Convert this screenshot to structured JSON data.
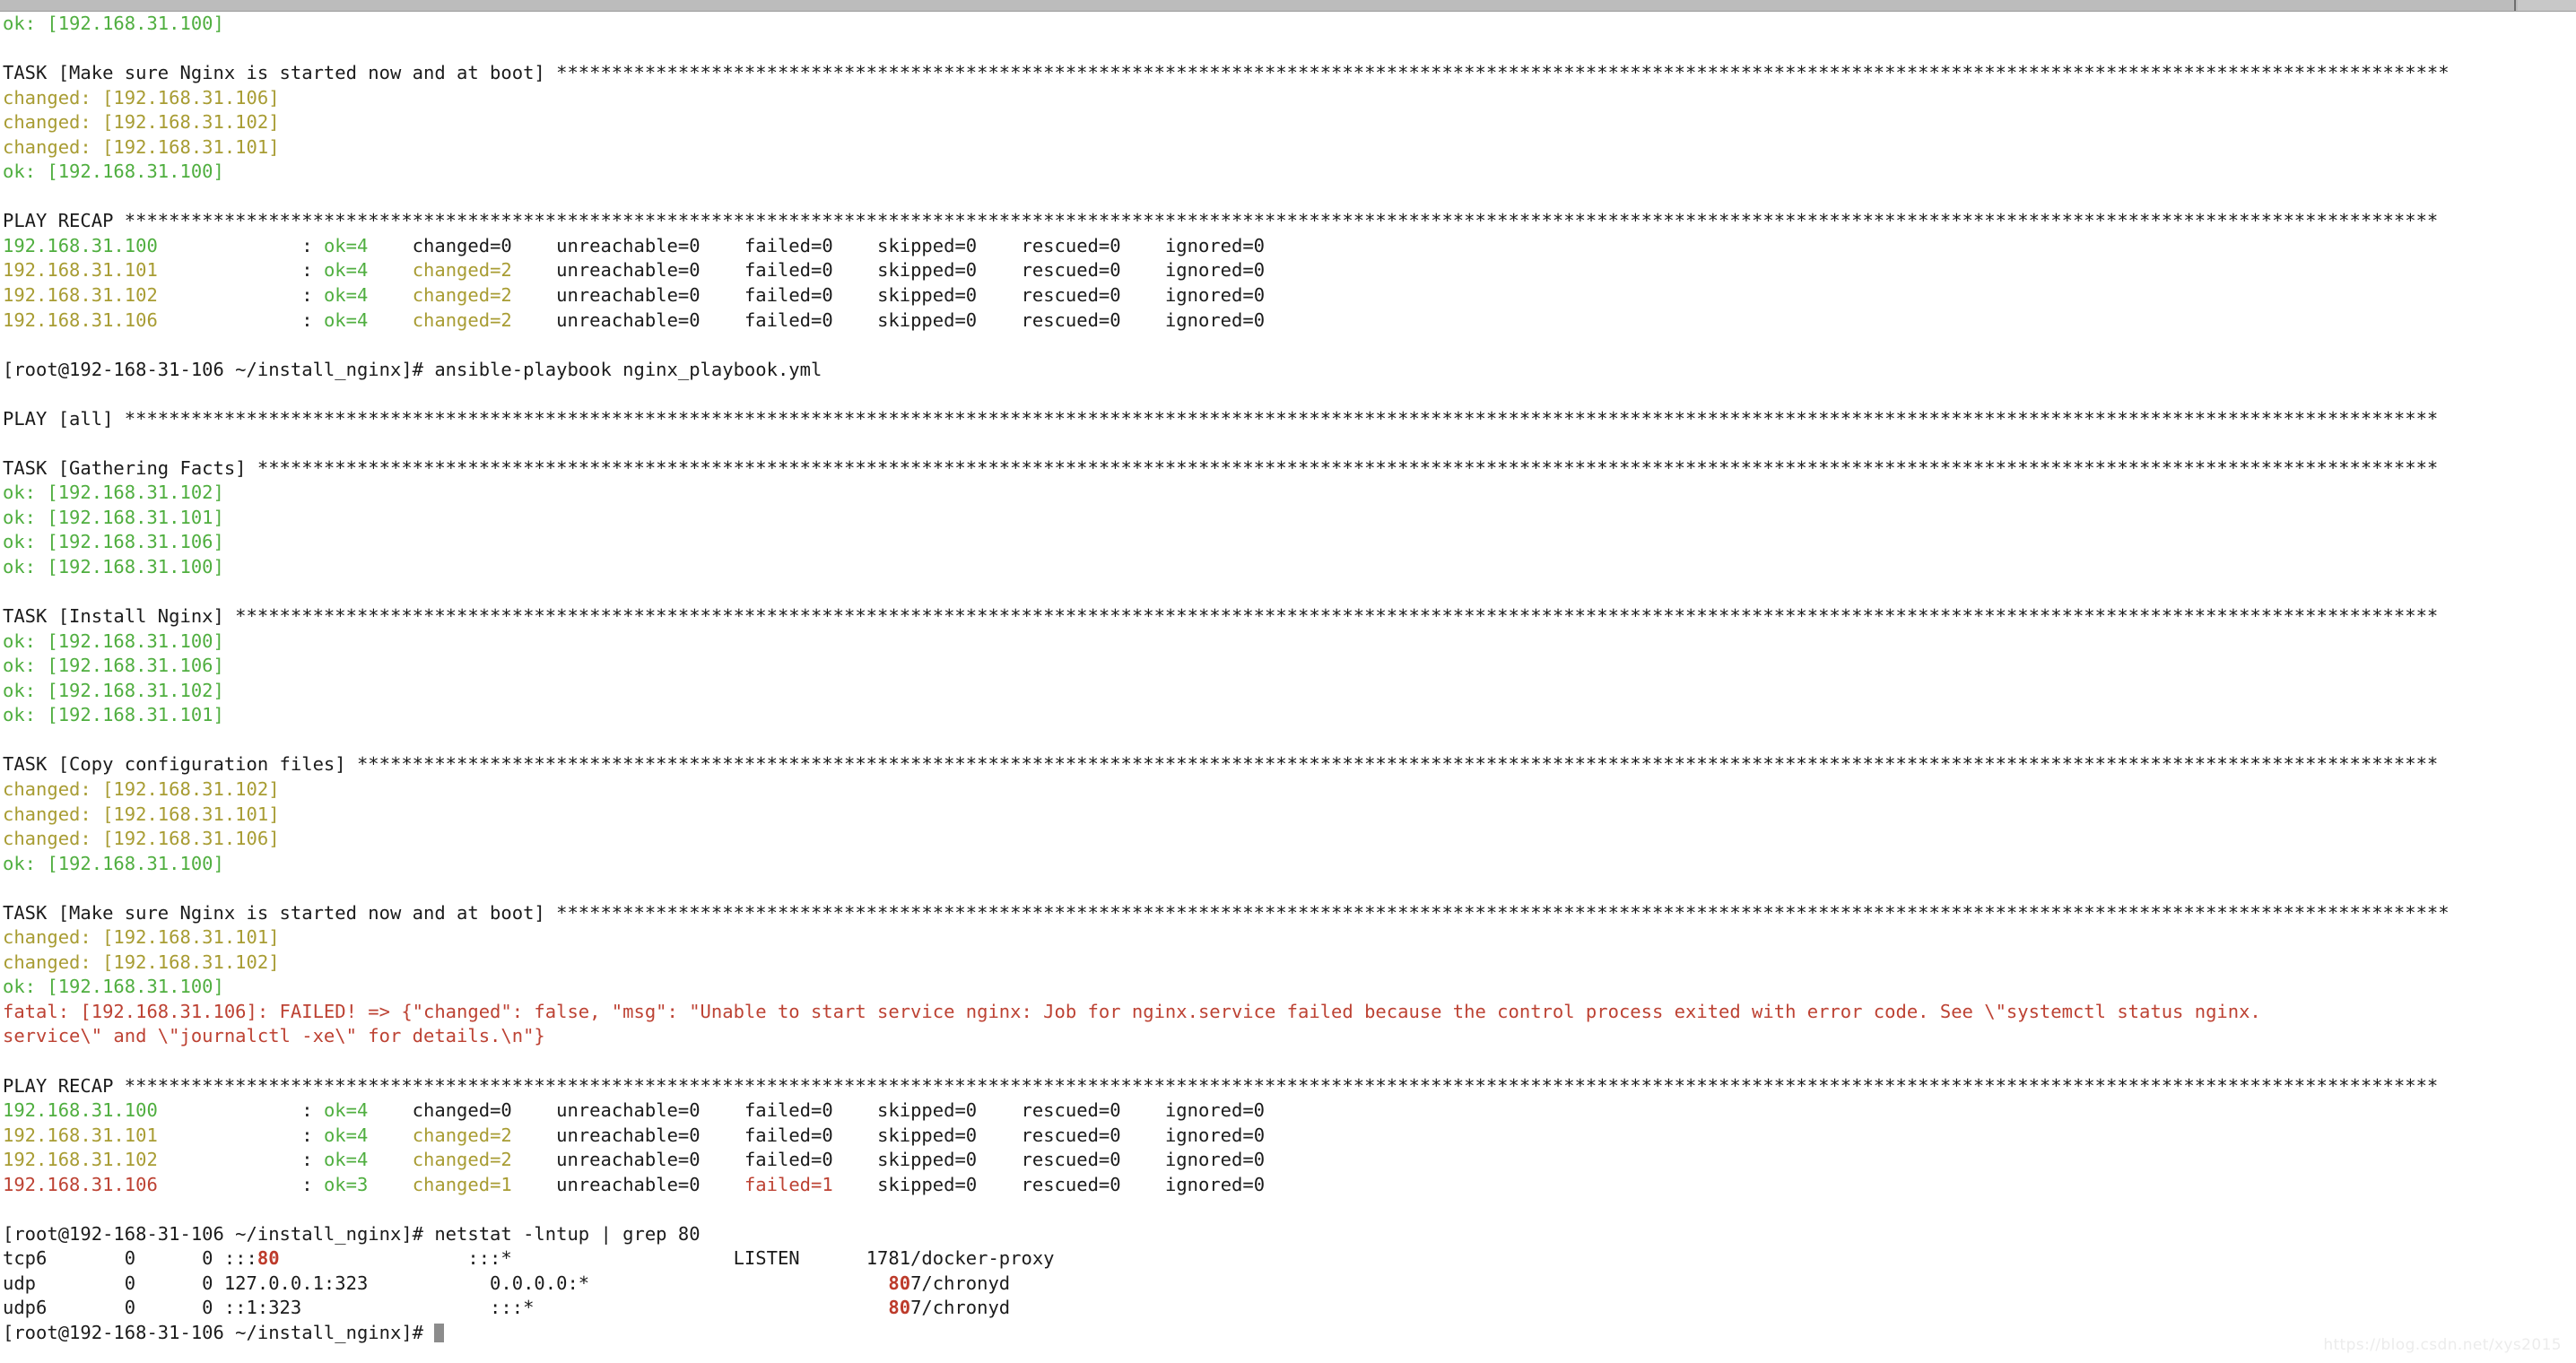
{
  "window": {
    "scrollbar": {
      "name": "horizontal-scrollbar",
      "orientation": "horizontal"
    },
    "watermark": "https://blog.csdn.net/xys2015"
  },
  "shell": {
    "prompt": "[root@192-168-31-106 ~/install_nginx]#",
    "commands": [
      "ansible-playbook nginx_playbook.yml",
      "netstat -lntup | grep 80"
    ],
    "cursor_visible": true
  },
  "colors": {
    "ok": "#4fae3f",
    "changed": "#a89c33",
    "fatal": "#bd4233",
    "plain": "#1b1b1b",
    "grep_highlight": "#bd3b2b",
    "background": "#ffffff",
    "scrollbar": "#bdbdbd"
  },
  "hosts": [
    "192.168.31.100",
    "192.168.31.101",
    "192.168.31.102",
    "192.168.31.106"
  ],
  "terminal_lines": [
    {
      "id": "l01",
      "segments": [
        {
          "text": "ok: [192.168.31.100]",
          "style": "ok"
        }
      ]
    },
    {
      "id": "l02",
      "segments": [
        {
          "text": "",
          "style": "plain"
        }
      ]
    },
    {
      "id": "l03",
      "segments": [
        {
          "text": "TASK [Make sure Nginx is started now and at boot] ***************************************************************************************************************************************************************************",
          "style": "plain"
        }
      ]
    },
    {
      "id": "l04",
      "segments": [
        {
          "text": "changed: [192.168.31.106]",
          "style": "changed"
        }
      ]
    },
    {
      "id": "l05",
      "segments": [
        {
          "text": "changed: [192.168.31.102]",
          "style": "changed"
        }
      ]
    },
    {
      "id": "l06",
      "segments": [
        {
          "text": "changed: [192.168.31.101]",
          "style": "changed"
        }
      ]
    },
    {
      "id": "l07",
      "segments": [
        {
          "text": "ok: [192.168.31.100]",
          "style": "ok"
        }
      ]
    },
    {
      "id": "l08",
      "segments": [
        {
          "text": "",
          "style": "plain"
        }
      ]
    },
    {
      "id": "l09",
      "segments": [
        {
          "text": "PLAY RECAP *****************************************************************************************************************************************************************************************************************",
          "style": "plain"
        }
      ]
    },
    {
      "id": "l10",
      "segments": [
        {
          "text": "192.168.31.100",
          "style": "ok"
        },
        {
          "text": "             : ",
          "style": "plain"
        },
        {
          "text": "ok=4",
          "style": "ok"
        },
        {
          "text": "    changed=0    unreachable=0    failed=0    skipped=0    rescued=0    ignored=0   ",
          "style": "plain"
        }
      ]
    },
    {
      "id": "l11",
      "segments": [
        {
          "text": "192.168.31.101",
          "style": "changed"
        },
        {
          "text": "             : ",
          "style": "plain"
        },
        {
          "text": "ok=4",
          "style": "ok"
        },
        {
          "text": "    ",
          "style": "plain"
        },
        {
          "text": "changed=2",
          "style": "changed"
        },
        {
          "text": "    unreachable=0    failed=0    skipped=0    rescued=0    ignored=0   ",
          "style": "plain"
        }
      ]
    },
    {
      "id": "l12",
      "segments": [
        {
          "text": "192.168.31.102",
          "style": "changed"
        },
        {
          "text": "             : ",
          "style": "plain"
        },
        {
          "text": "ok=4",
          "style": "ok"
        },
        {
          "text": "    ",
          "style": "plain"
        },
        {
          "text": "changed=2",
          "style": "changed"
        },
        {
          "text": "    unreachable=0    failed=0    skipped=0    rescued=0    ignored=0   ",
          "style": "plain"
        }
      ]
    },
    {
      "id": "l13",
      "segments": [
        {
          "text": "192.168.31.106",
          "style": "changed"
        },
        {
          "text": "             : ",
          "style": "plain"
        },
        {
          "text": "ok=4",
          "style": "ok"
        },
        {
          "text": "    ",
          "style": "plain"
        },
        {
          "text": "changed=2",
          "style": "changed"
        },
        {
          "text": "    unreachable=0    failed=0    skipped=0    rescued=0    ignored=0   ",
          "style": "plain"
        }
      ]
    },
    {
      "id": "l14",
      "segments": [
        {
          "text": "",
          "style": "plain"
        }
      ]
    },
    {
      "id": "l15",
      "segments": [
        {
          "text": "[root@192-168-31-106 ~/install_nginx]# ansible-playbook nginx_playbook.yml",
          "style": "plain"
        }
      ]
    },
    {
      "id": "l16",
      "segments": [
        {
          "text": "",
          "style": "plain"
        }
      ]
    },
    {
      "id": "l17",
      "segments": [
        {
          "text": "PLAY [all] *****************************************************************************************************************************************************************************************************************",
          "style": "plain"
        }
      ]
    },
    {
      "id": "l18",
      "segments": [
        {
          "text": "",
          "style": "plain"
        }
      ]
    },
    {
      "id": "l19",
      "segments": [
        {
          "text": "TASK [Gathering Facts] *****************************************************************************************************************************************************************************************************",
          "style": "plain"
        }
      ]
    },
    {
      "id": "l20",
      "segments": [
        {
          "text": "ok: [192.168.31.102]",
          "style": "ok"
        }
      ]
    },
    {
      "id": "l21",
      "segments": [
        {
          "text": "ok: [192.168.31.101]",
          "style": "ok"
        }
      ]
    },
    {
      "id": "l22",
      "segments": [
        {
          "text": "ok: [192.168.31.106]",
          "style": "ok"
        }
      ]
    },
    {
      "id": "l23",
      "segments": [
        {
          "text": "ok: [192.168.31.100]",
          "style": "ok"
        }
      ]
    },
    {
      "id": "l24",
      "segments": [
        {
          "text": "",
          "style": "plain"
        }
      ]
    },
    {
      "id": "l25",
      "segments": [
        {
          "text": "TASK [Install Nginx] *******************************************************************************************************************************************************************************************************",
          "style": "plain"
        }
      ]
    },
    {
      "id": "l26",
      "segments": [
        {
          "text": "ok: [192.168.31.100]",
          "style": "ok"
        }
      ]
    },
    {
      "id": "l27",
      "segments": [
        {
          "text": "ok: [192.168.31.106]",
          "style": "ok"
        }
      ]
    },
    {
      "id": "l28",
      "segments": [
        {
          "text": "ok: [192.168.31.102]",
          "style": "ok"
        }
      ]
    },
    {
      "id": "l29",
      "segments": [
        {
          "text": "ok: [192.168.31.101]",
          "style": "ok"
        }
      ]
    },
    {
      "id": "l30",
      "segments": [
        {
          "text": "",
          "style": "plain"
        }
      ]
    },
    {
      "id": "l31",
      "segments": [
        {
          "text": "TASK [Copy configuration files] ********************************************************************************************************************************************************************************************",
          "style": "plain"
        }
      ]
    },
    {
      "id": "l32",
      "segments": [
        {
          "text": "changed: [192.168.31.102]",
          "style": "changed"
        }
      ]
    },
    {
      "id": "l33",
      "segments": [
        {
          "text": "changed: [192.168.31.101]",
          "style": "changed"
        }
      ]
    },
    {
      "id": "l34",
      "segments": [
        {
          "text": "changed: [192.168.31.106]",
          "style": "changed"
        }
      ]
    },
    {
      "id": "l35",
      "segments": [
        {
          "text": "ok: [192.168.31.100]",
          "style": "ok"
        }
      ]
    },
    {
      "id": "l36",
      "segments": [
        {
          "text": "",
          "style": "plain"
        }
      ]
    },
    {
      "id": "l37",
      "segments": [
        {
          "text": "TASK [Make sure Nginx is started now and at boot] ***************************************************************************************************************************************************************************",
          "style": "plain"
        }
      ]
    },
    {
      "id": "l38",
      "segments": [
        {
          "text": "changed: [192.168.31.101]",
          "style": "changed"
        }
      ]
    },
    {
      "id": "l39",
      "segments": [
        {
          "text": "changed: [192.168.31.102]",
          "style": "changed"
        }
      ]
    },
    {
      "id": "l40",
      "segments": [
        {
          "text": "ok: [192.168.31.100]",
          "style": "ok"
        }
      ]
    },
    {
      "id": "l41",
      "segments": [
        {
          "text": "fatal: [192.168.31.106]: FAILED! => {\"changed\": false, \"msg\": \"Unable to start service nginx: Job for nginx.service failed because the control process exited with error code. See \\\"systemctl status nginx.",
          "style": "fatal"
        }
      ]
    },
    {
      "id": "l42",
      "segments": [
        {
          "text": "service\\\" and \\\"journalctl -xe\\\" for details.\\n\"}",
          "style": "fatal"
        }
      ]
    },
    {
      "id": "l43",
      "segments": [
        {
          "text": "",
          "style": "plain"
        }
      ]
    },
    {
      "id": "l44",
      "segments": [
        {
          "text": "PLAY RECAP *****************************************************************************************************************************************************************************************************************",
          "style": "plain"
        }
      ]
    },
    {
      "id": "l45",
      "segments": [
        {
          "text": "192.168.31.100",
          "style": "ok"
        },
        {
          "text": "             : ",
          "style": "plain"
        },
        {
          "text": "ok=4",
          "style": "ok"
        },
        {
          "text": "    changed=0    unreachable=0    failed=0    skipped=0    rescued=0    ignored=0   ",
          "style": "plain"
        }
      ]
    },
    {
      "id": "l46",
      "segments": [
        {
          "text": "192.168.31.101",
          "style": "changed"
        },
        {
          "text": "             : ",
          "style": "plain"
        },
        {
          "text": "ok=4",
          "style": "ok"
        },
        {
          "text": "    ",
          "style": "plain"
        },
        {
          "text": "changed=2",
          "style": "changed"
        },
        {
          "text": "    unreachable=0    failed=0    skipped=0    rescued=0    ignored=0   ",
          "style": "plain"
        }
      ]
    },
    {
      "id": "l47",
      "segments": [
        {
          "text": "192.168.31.102",
          "style": "changed"
        },
        {
          "text": "             : ",
          "style": "plain"
        },
        {
          "text": "ok=4",
          "style": "ok"
        },
        {
          "text": "    ",
          "style": "plain"
        },
        {
          "text": "changed=2",
          "style": "changed"
        },
        {
          "text": "    unreachable=0    failed=0    skipped=0    rescued=0    ignored=0   ",
          "style": "plain"
        }
      ]
    },
    {
      "id": "l48",
      "segments": [
        {
          "text": "192.168.31.106",
          "style": "fatal"
        },
        {
          "text": "             : ",
          "style": "plain"
        },
        {
          "text": "ok=3",
          "style": "ok"
        },
        {
          "text": "    ",
          "style": "plain"
        },
        {
          "text": "changed=1",
          "style": "changed"
        },
        {
          "text": "    unreachable=0    ",
          "style": "plain"
        },
        {
          "text": "failed=1",
          "style": "fatal"
        },
        {
          "text": "    skipped=0    rescued=0    ignored=0   ",
          "style": "plain"
        }
      ]
    },
    {
      "id": "l49",
      "segments": [
        {
          "text": "",
          "style": "plain"
        }
      ]
    },
    {
      "id": "l50",
      "segments": [
        {
          "text": "[root@192-168-31-106 ~/install_nginx]# netstat -lntup | grep 80",
          "style": "plain"
        }
      ]
    },
    {
      "id": "l51",
      "segments": [
        {
          "text": "tcp6       0      0 :::",
          "style": "plain"
        },
        {
          "text": "80",
          "style": "grep"
        },
        {
          "text": "                 :::*                    LISTEN      1781/docker-proxy",
          "style": "plain"
        }
      ]
    },
    {
      "id": "l52",
      "segments": [
        {
          "text": "udp        0      0 127.0.0.1:323           0.0.0.0:*                           ",
          "style": "plain"
        },
        {
          "text": "80",
          "style": "grep"
        },
        {
          "text": "7/chronyd",
          "style": "plain"
        }
      ]
    },
    {
      "id": "l53",
      "segments": [
        {
          "text": "udp6       0      0 ::1:323                 :::*                                ",
          "style": "plain"
        },
        {
          "text": "80",
          "style": "grep"
        },
        {
          "text": "7/chronyd",
          "style": "plain"
        }
      ]
    },
    {
      "id": "l54",
      "segments": [
        {
          "text": "[root@192-168-31-106 ~/install_nginx]# ",
          "style": "plain"
        }
      ],
      "cursor": true
    }
  ]
}
